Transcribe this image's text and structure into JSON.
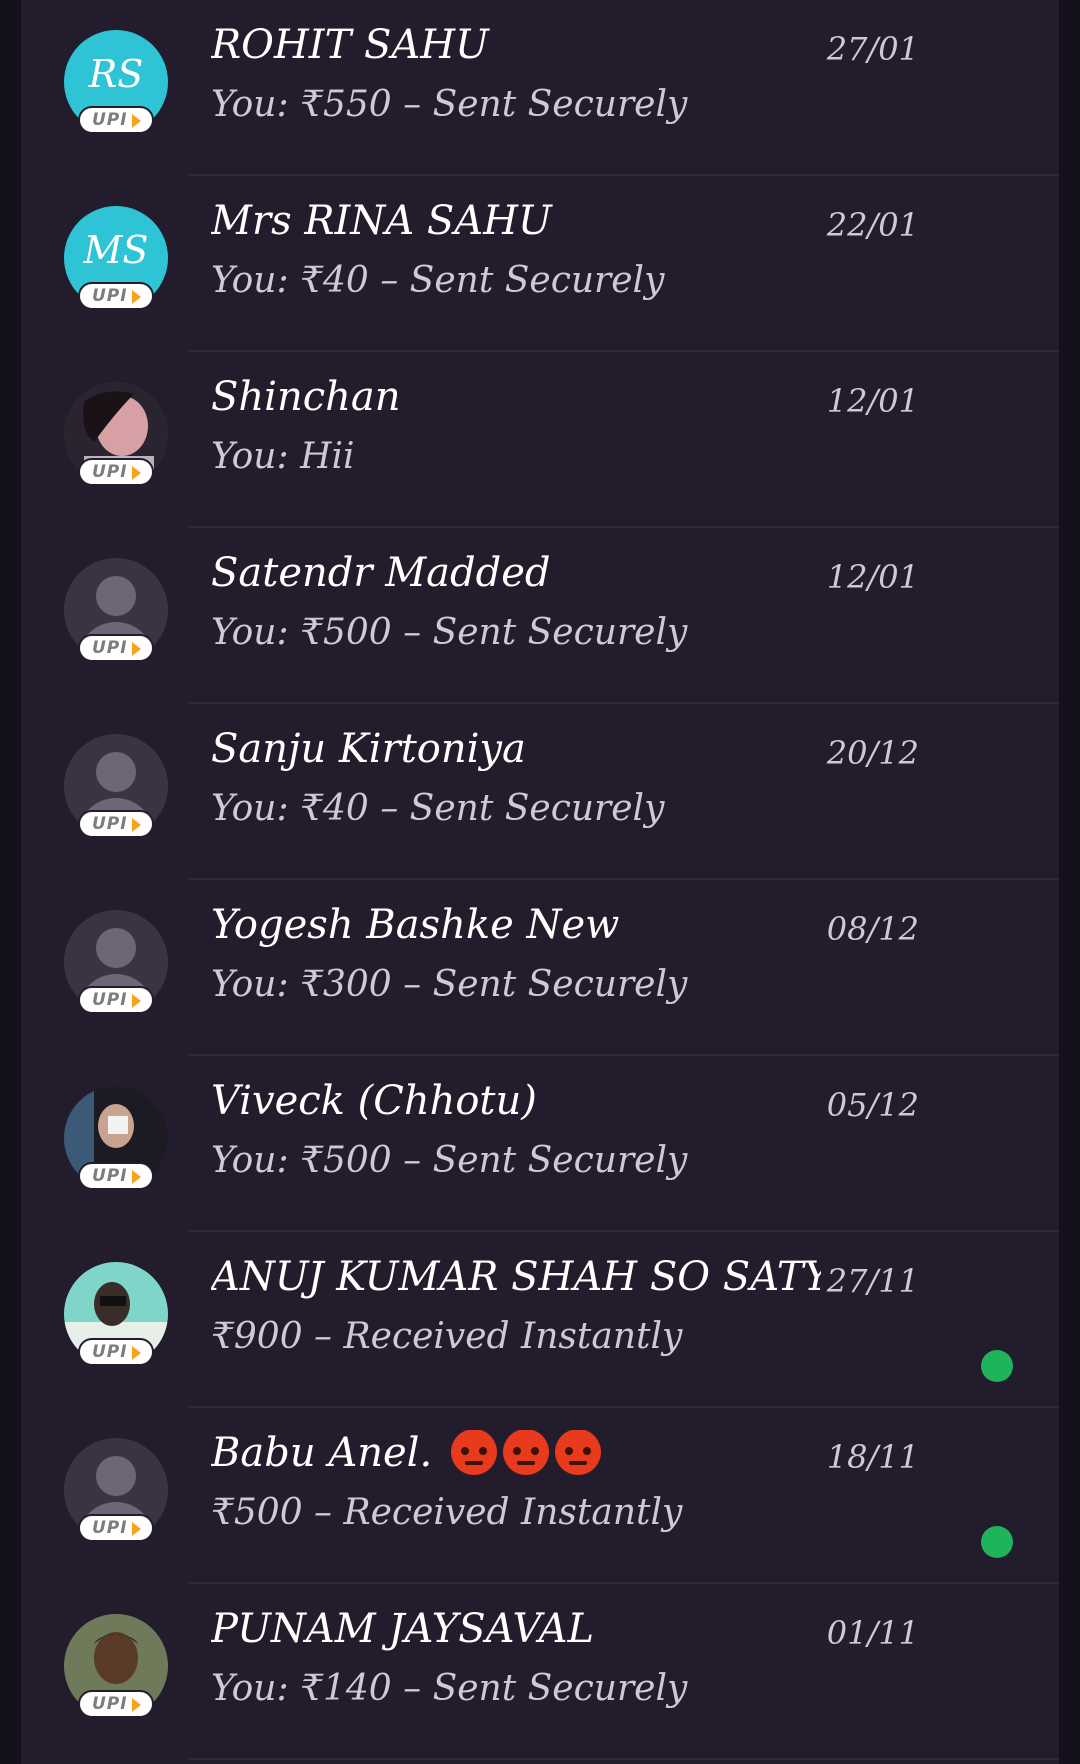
{
  "badge_label": "UPI",
  "colors": {
    "background": "#15111c",
    "list_background": "#221c2c",
    "initials_avatar": "#2ec4d6",
    "received_dot": "#1fb35a",
    "upi_arrow": "#f6a21c"
  },
  "conversations": [
    {
      "avatar": "initials",
      "initials": "RS",
      "name": "ROHIT  SAHU",
      "preview": "You: ₹550 – Sent Securely",
      "date": "27/01",
      "received_dot": false
    },
    {
      "avatar": "initials",
      "initials": "MS",
      "name": "Mrs RINA  SAHU",
      "preview": "You: ₹40 – Sent Securely",
      "date": "22/01",
      "received_dot": false
    },
    {
      "avatar": "photo",
      "name": "Shinchan",
      "preview": "You: Hii",
      "date": "12/01",
      "received_dot": false
    },
    {
      "avatar": "placeholder",
      "name": "Satendr Madded",
      "preview": "You: ₹500 – Sent Securely",
      "date": "12/01",
      "received_dot": false
    },
    {
      "avatar": "placeholder",
      "name": "Sanju Kirtoniya",
      "preview": "You: ₹40 – Sent Securely",
      "date": "20/12",
      "received_dot": false
    },
    {
      "avatar": "placeholder",
      "name": "Yogesh Bashke New",
      "preview": "You: ₹300 – Sent Securely",
      "date": "08/12",
      "received_dot": false
    },
    {
      "avatar": "photo",
      "name": "Viveck (Chhotu)",
      "preview": "You: ₹500 – Sent Securely",
      "date": "05/12",
      "received_dot": false
    },
    {
      "avatar": "photo",
      "name": "ANUJ KUMAR SHAH SO SATYDEV...",
      "preview": "₹900 – Received Instantly",
      "date": "27/11",
      "received_dot": true
    },
    {
      "avatar": "placeholder",
      "name": "Babu Anel.",
      "emoji": [
        "angry-face-icon",
        "angry-face-icon",
        "angry-face-icon"
      ],
      "preview": "₹500 – Received Instantly",
      "date": "18/11",
      "received_dot": true
    },
    {
      "avatar": "photo",
      "name": "PUNAM JAYSAVAL",
      "preview": "You: ₹140 – Sent Securely",
      "date": "01/11",
      "received_dot": false
    }
  ]
}
